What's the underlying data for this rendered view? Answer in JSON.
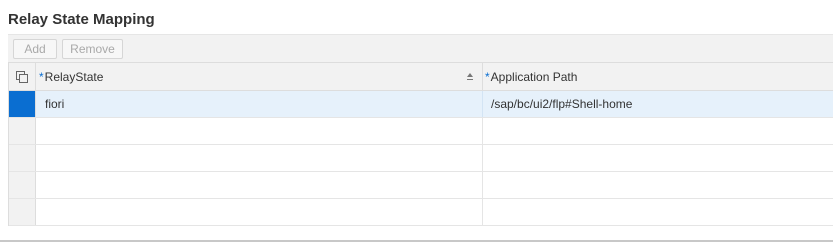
{
  "section": {
    "title": "Relay State Mapping"
  },
  "toolbar": {
    "add_label": "Add",
    "remove_label": "Remove"
  },
  "table": {
    "columns": [
      {
        "label": "RelayState",
        "required": "*"
      },
      {
        "label": "Application Path",
        "required": "*"
      }
    ],
    "rows": [
      {
        "relay_state": "fiori",
        "application_path": "/sap/bc/ui2/flp#Shell-home",
        "selected": true
      },
      {
        "relay_state": "",
        "application_path": ""
      },
      {
        "relay_state": "",
        "application_path": ""
      },
      {
        "relay_state": "",
        "application_path": ""
      },
      {
        "relay_state": "",
        "application_path": ""
      }
    ]
  },
  "icons": {
    "select_all": "select-all-icon",
    "sort": "sort-ascending-icon"
  },
  "colors": {
    "accent": "#0a6ed1",
    "selected_row": "#e6f1fb",
    "toolbar_bg": "#f2f2f2"
  }
}
